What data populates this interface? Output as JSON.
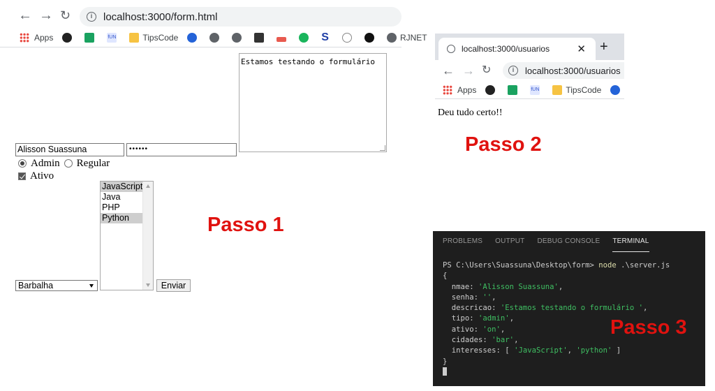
{
  "browser1": {
    "url": "localhost:3000/form.html",
    "bookmarks": [
      {
        "label": "Apps",
        "icon": "apps-grid-icon"
      },
      {
        "label": "",
        "icon": "avatar-icon"
      },
      {
        "label": "",
        "icon": "green-bookmark-icon"
      },
      {
        "label": "",
        "icon": "fun-icon"
      },
      {
        "label": "TipsCode",
        "icon": "folder-icon"
      },
      {
        "label": "",
        "icon": "d-icon"
      },
      {
        "label": "",
        "icon": "globe-icon"
      },
      {
        "label": "",
        "icon": "globe-icon"
      },
      {
        "label": "",
        "icon": "bus-icon"
      },
      {
        "label": "",
        "icon": "hat-icon"
      },
      {
        "label": "",
        "icon": "play-icon"
      },
      {
        "label": "",
        "icon": "s-icon"
      },
      {
        "label": "",
        "icon": "circle-icon"
      },
      {
        "label": "",
        "icon": "github-icon"
      },
      {
        "label": "RJNET",
        "icon": "globe-icon"
      }
    ]
  },
  "form": {
    "descricao": "Estamos testando o formulário",
    "nome": "Alisson Suassuna",
    "senha_mask": "••••••",
    "radio_admin": "Admin",
    "radio_regular": "Regular",
    "check_ativo": "Ativo",
    "interesses": [
      {
        "label": "JavaScript",
        "selected": true
      },
      {
        "label": "Java",
        "selected": false
      },
      {
        "label": "PHP",
        "selected": false
      },
      {
        "label": "Python",
        "selected": true
      }
    ],
    "cidade": "Barbalha",
    "submit": "Enviar"
  },
  "captions": {
    "passo1": "Passo 1",
    "passo2": "Passo 2",
    "passo3": "Passo 3"
  },
  "browser2": {
    "tab_title": "localhost:3000/usuarios",
    "url": "localhost:3000/usuarios",
    "bookmarks": [
      {
        "label": "Apps"
      },
      {
        "label": "TipsCode"
      }
    ],
    "page_text": "Deu tudo certo!!"
  },
  "terminal": {
    "tabs": [
      "PROBLEMS",
      "OUTPUT",
      "DEBUG CONSOLE",
      "TERMINAL"
    ],
    "active_tab": "TERMINAL",
    "prompt": "PS C:\\Users\\Suassuna\\Desktop\\form> ",
    "cmd": "node",
    "cmd_arg": " .\\server.js",
    "open_brace": "{",
    "lines": [
      {
        "key": "  nmae: ",
        "value": "'Alisson Suassuna'",
        "end": ","
      },
      {
        "key": "  senha: ",
        "value": "''",
        "end": ","
      },
      {
        "key": "  descricao: ",
        "value": "'Estamos testando o formulário '",
        "end": ","
      },
      {
        "key": "  tipo: ",
        "value": "'admin'",
        "end": ","
      },
      {
        "key": "  ativo: ",
        "value": "'on'",
        "end": ","
      },
      {
        "key": "  cidades: ",
        "value": "'bar'",
        "end": ","
      }
    ],
    "interesses_key": "  interesses: [ ",
    "interesses_v1": "'JavaScript'",
    "interesses_sep": ", ",
    "interesses_v2": "'python'",
    "interesses_end": " ]",
    "close_brace": "}"
  }
}
